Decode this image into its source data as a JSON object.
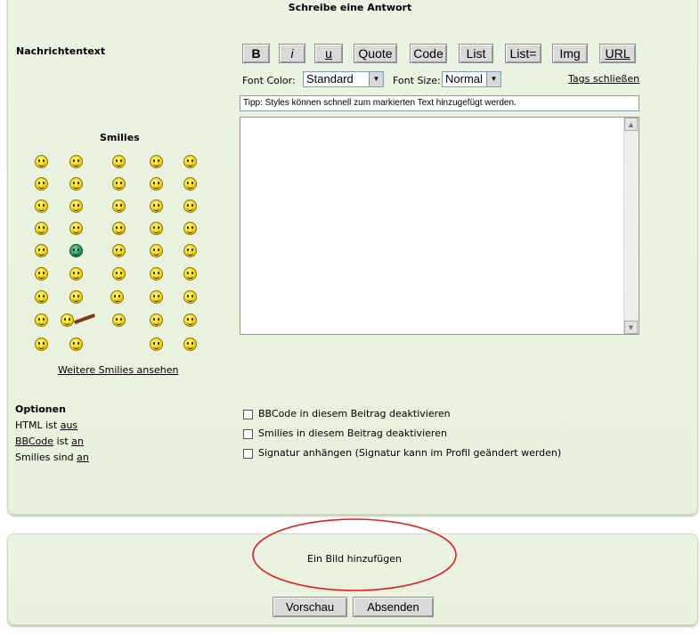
{
  "header": {
    "title": "Schreibe eine Antwort"
  },
  "left": {
    "message_label": "Nachrichtentext",
    "smilies_heading": "Smilies",
    "more_smilies_link": "Weitere Smilies ansehen",
    "options_heading": "Optionen",
    "html_prefix": "HTML ist",
    "html_value": "aus",
    "bbcode_link": "BBCode",
    "bbcode_mid": "ist",
    "bbcode_value": "an",
    "smilies_prefix": "Smilies sind",
    "smilies_value": "an"
  },
  "toolbar": {
    "bold": "B",
    "italic": "i",
    "underline": "u",
    "quote": "Quote",
    "code": "Code",
    "list": "List",
    "list_eq": "List=",
    "img": "Img",
    "url": "URL",
    "font_color_label": "Font Color:",
    "font_color_value": "Standard",
    "font_size_label": "Font Size:",
    "font_size_value": "Normal",
    "close_tags": "Tags schließen"
  },
  "tip_text": "Tipp: Styles können schnell zum markierten Text hinzugefügt werden.",
  "checkboxes": {
    "disable_bbcode": "BBCode in diesem Beitrag deaktivieren",
    "disable_smilies": "Smilies in diesem Beitrag deaktivieren",
    "attach_signature": "Signatur anhängen (Signatur kann im Profil geändert werden)"
  },
  "bottom": {
    "add_image": "Ein Bild hinzufügen",
    "annotation_color": "#e02020",
    "preview_button": "Vorschau",
    "submit_button": "Absenden"
  },
  "colors": {
    "panel": "#edf3e3",
    "button": "#d9d9d9"
  }
}
